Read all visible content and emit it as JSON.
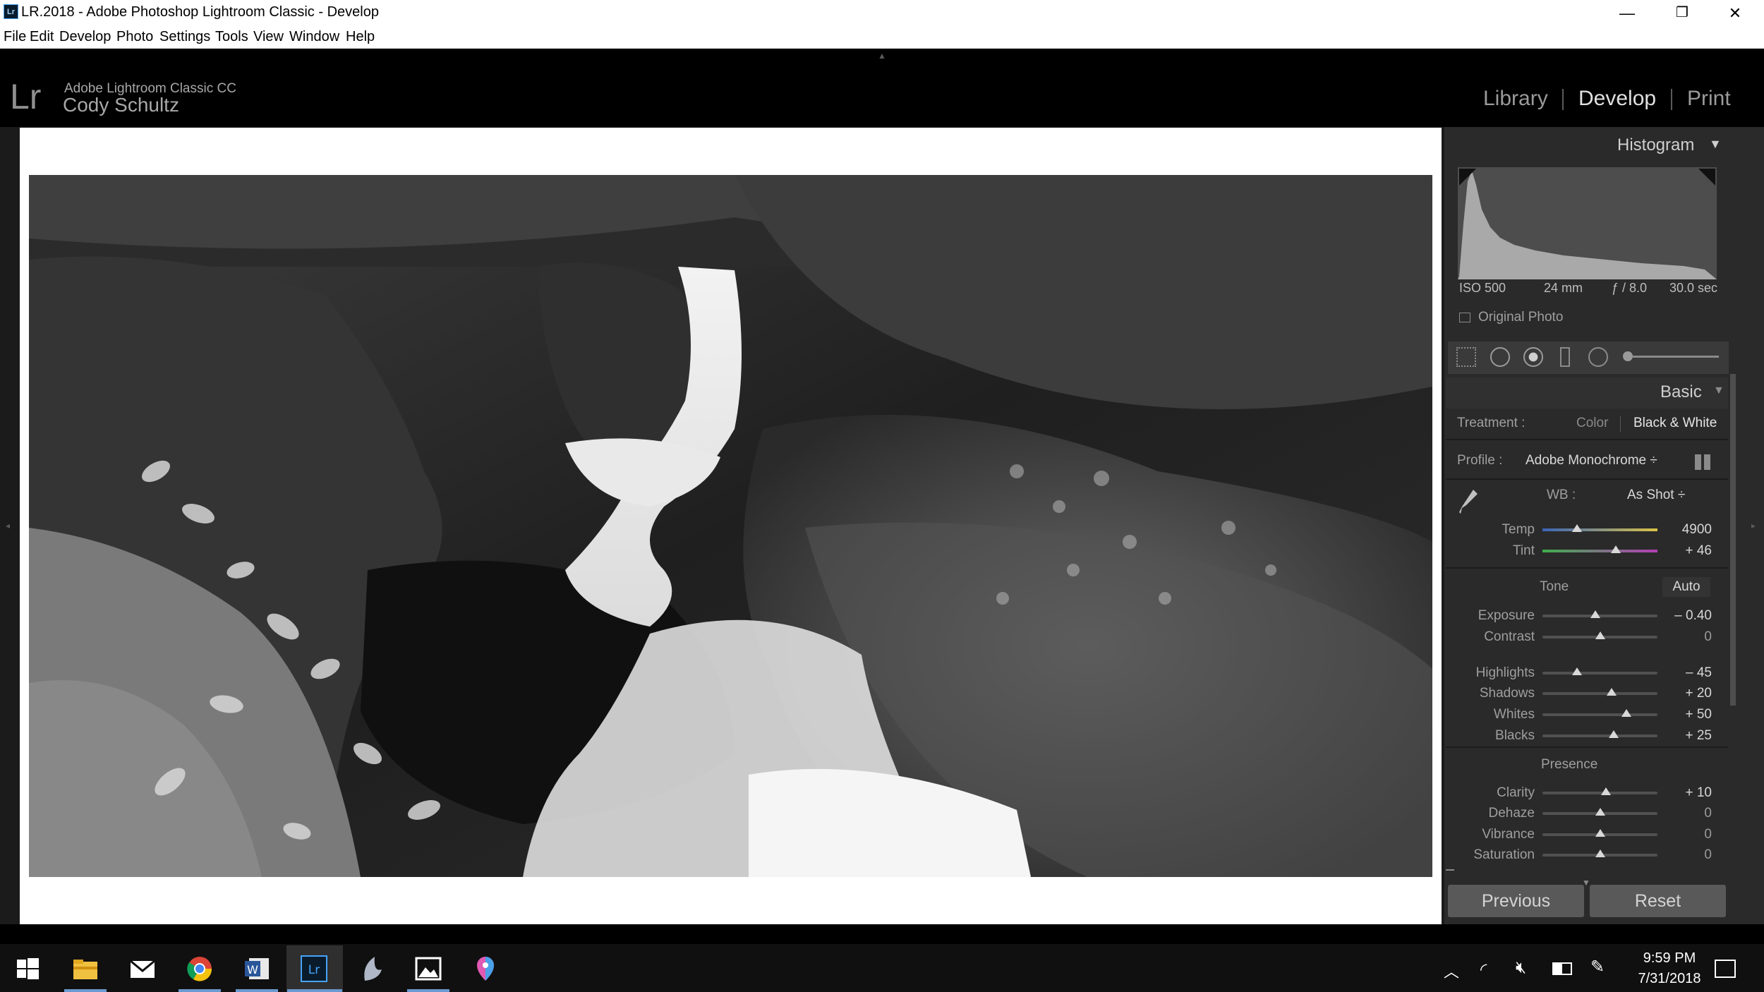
{
  "window": {
    "title": "LR.2018 - Adobe Photoshop Lightroom Classic - Develop",
    "app_icon": "Lr",
    "minimize": "—",
    "restore": "❐",
    "close": "✕"
  },
  "menu": [
    "File",
    "Edit",
    "Develop",
    "Photo",
    "Settings",
    "Tools",
    "View",
    "Window",
    "Help"
  ],
  "identity": {
    "logo": "Lr",
    "product": "Adobe Lightroom Classic CC",
    "user": "Cody Schultz"
  },
  "modules": [
    "Library",
    "Develop",
    "Print"
  ],
  "active_module": "Develop",
  "histogram": {
    "title": "Histogram",
    "iso": "ISO 500",
    "focal": "24 mm",
    "aperture": "ƒ / 8.0",
    "shutter": "30.0 sec",
    "original_photo": "Original Photo"
  },
  "basic": {
    "title": "Basic",
    "treatment_label": "Treatment :",
    "treatment_color": "Color",
    "treatment_bw": "Black & White",
    "profile_label": "Profile :",
    "profile_value": "Adobe Monochrome ÷",
    "wb_label": "WB :",
    "wb_value": "As Shot ÷",
    "temp_label": "Temp",
    "temp_value": "4900",
    "temp_level": 0.3,
    "tint_label": "Tint",
    "tint_value": "+ 46",
    "tint_level": 0.64,
    "tone_label": "Tone",
    "auto_label": "Auto",
    "presence_label": "Presence",
    "sliders": [
      {
        "label": "Exposure",
        "value": "– 0.40",
        "level": 0.46
      },
      {
        "label": "Contrast",
        "value": "0",
        "level": 0.5
      },
      {
        "label": "Highlights",
        "value": "– 45",
        "level": 0.3
      },
      {
        "label": "Shadows",
        "value": "+ 20",
        "level": 0.6
      },
      {
        "label": "Whites",
        "value": "+ 50",
        "level": 0.73
      },
      {
        "label": "Blacks",
        "value": "+ 25",
        "level": 0.62
      },
      {
        "label": "Clarity",
        "value": "+ 10",
        "level": 0.55
      },
      {
        "label": "Dehaze",
        "value": "0",
        "level": 0.5
      },
      {
        "label": "Vibrance",
        "value": "0",
        "level": 0.5
      },
      {
        "label": "Saturation",
        "value": "0",
        "level": 0.5
      }
    ]
  },
  "buttons": {
    "previous": "Previous",
    "reset": "Reset"
  },
  "taskbar": {
    "time": "9:59 PM",
    "date": "7/31/2018",
    "apps": [
      "windows-start-icon",
      "file-explorer-icon",
      "mail-icon",
      "chrome-icon",
      "word-icon",
      "lightroom-icon",
      "paint-icon",
      "photos-icon",
      "maps-icon"
    ]
  },
  "colors": {
    "panel_bg": "#2a2a2a",
    "accent_blue": "#6a9ad0"
  }
}
